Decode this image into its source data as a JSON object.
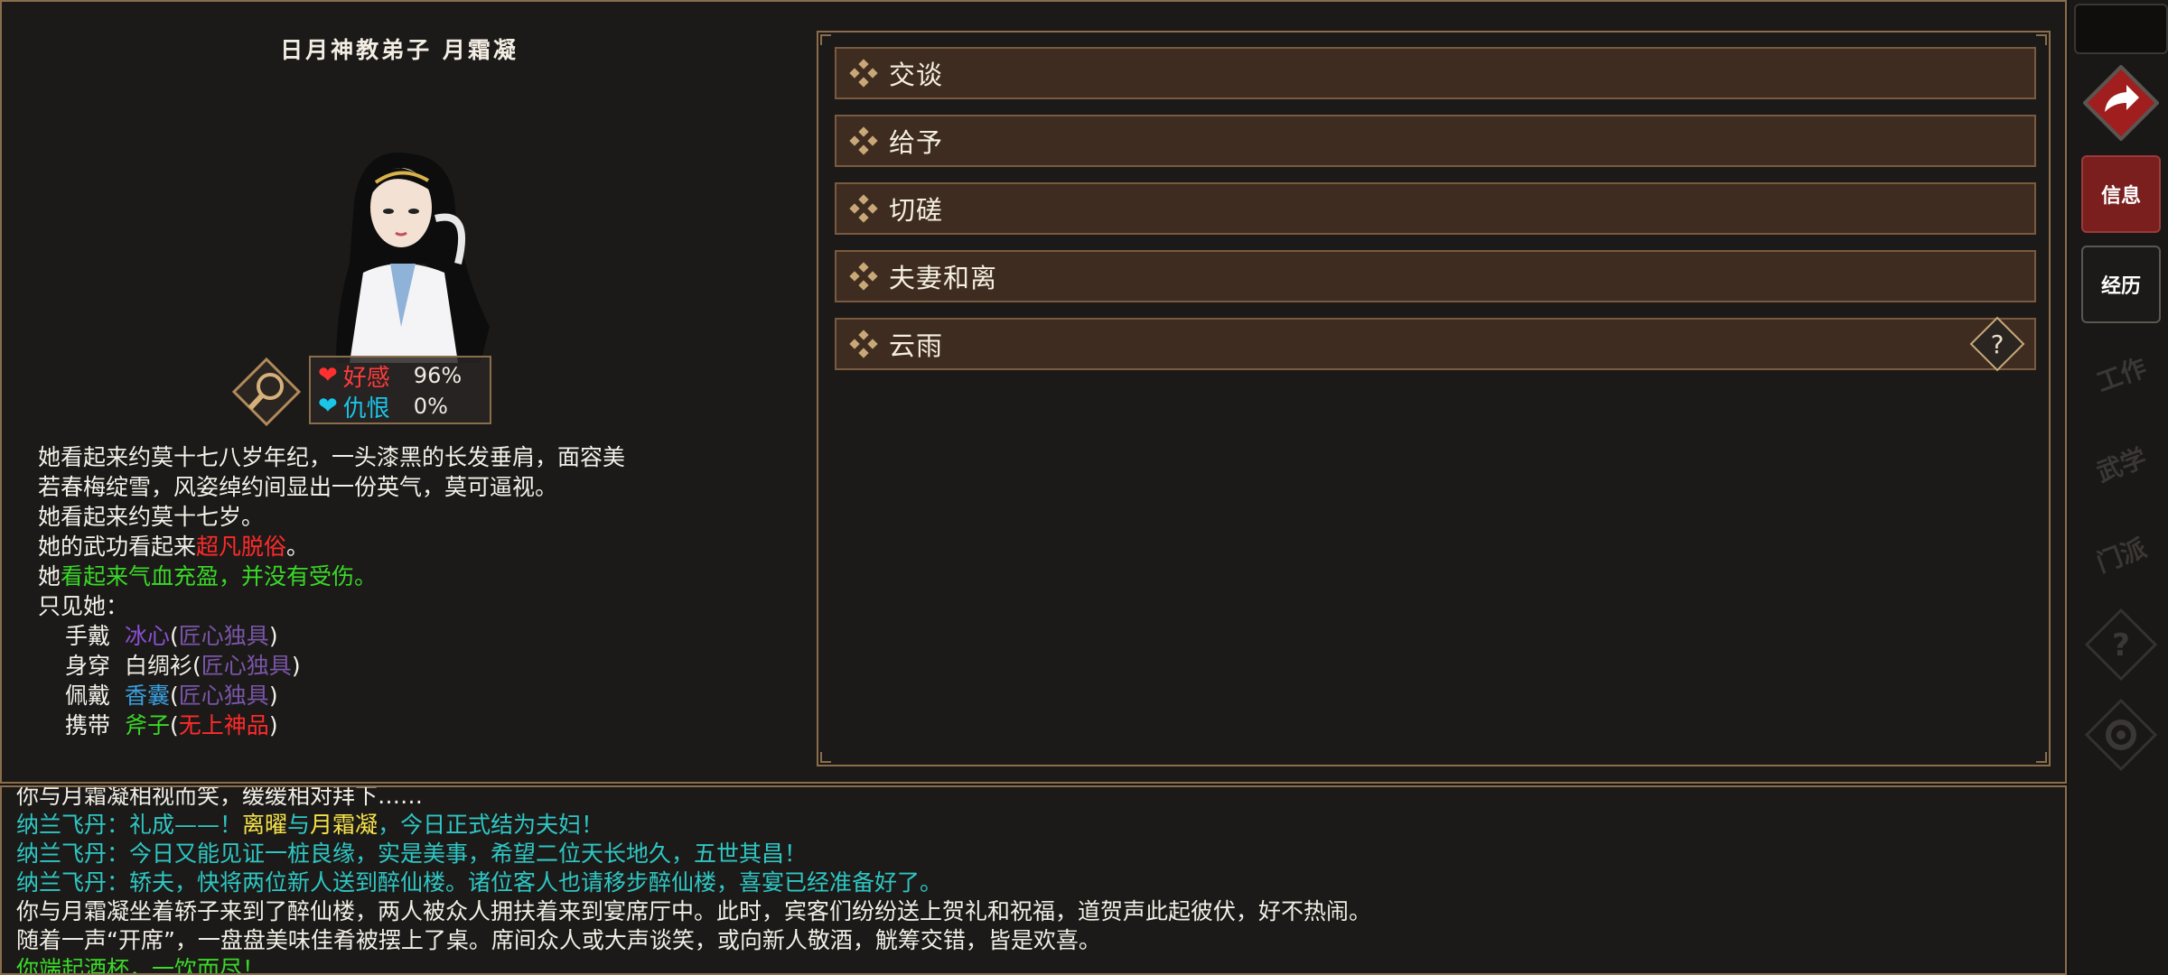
{
  "npc": {
    "title": "日月神教弟子  月霜凝",
    "favor_label": "好感",
    "favor_value": "96%",
    "hatred_label": "仇恨",
    "hatred_value": "0%",
    "favor_percent": 96,
    "hatred_percent": 0
  },
  "description": {
    "line1": "她看起来约莫十七八岁年纪，一头漆黑的长发垂肩，面容美",
    "line2": "若春梅绽雪，风姿绰约间显出一份英气，莫可逼视。",
    "line3": "她看起来约莫十七岁。",
    "martial_prefix": "她的武功看起来",
    "martial_value": "超凡脱俗",
    "martial_suffix": "。",
    "health_prefix": "她",
    "health_value": "看起来气血充盈，并没有受伤。",
    "equip_header": "只见她："
  },
  "equipment": [
    {
      "slot": "手戴",
      "item": "冰心",
      "open": "(",
      "quality": "匠心独具",
      "close": ")"
    },
    {
      "slot": "身穿",
      "item": "白绸衫",
      "open": "(",
      "quality": "匠心独具",
      "close": ")"
    },
    {
      "slot": "佩戴",
      "item": "香囊",
      "open": "(",
      "quality": "匠心独具",
      "close": ")"
    },
    {
      "slot": "携带",
      "item": "斧子",
      "open": "(",
      "quality": "无上神品",
      "close": ")"
    }
  ],
  "actions": [
    {
      "label": "交谈"
    },
    {
      "label": "给予"
    },
    {
      "label": "切磋"
    },
    {
      "label": "夫妻和离"
    },
    {
      "label": "云雨"
    }
  ],
  "sidebar": {
    "tabs": [
      {
        "label": "信息",
        "active": true
      },
      {
        "label": "经历",
        "active": false
      }
    ],
    "disabled": [
      {
        "label": "工作",
        "icon": "work-icon"
      },
      {
        "label": "武学",
        "icon": "martial-icon"
      },
      {
        "label": "门派",
        "icon": "sect-icon"
      },
      {
        "label": "?",
        "icon": "help-icon"
      },
      {
        "label": "",
        "icon": "gear-icon"
      }
    ]
  },
  "log": {
    "l0": "你与月霜凝相视而笑，缓缓相对拜下……",
    "l1a": "纳兰飞丹：礼成——！",
    "l1b": "离曜",
    "l1c": "与",
    "l1d": "月霜凝",
    "l1e": "，今日正式结为夫妇！",
    "l2": "纳兰飞丹：今日又能见证一桩良缘，实是美事，希望二位天长地久，五世其昌！",
    "l3": "纳兰飞丹：轿夫，快将两位新人送到醉仙楼。诸位客人也请移步醉仙楼，喜宴已经准备好了。",
    "l4": "你与月霜凝坐着轿子来到了醉仙楼，两人被众人拥扶着来到宴席厅中。此时，宾客们纷纷送上贺礼和祝福，道贺声此起彼伏，好不热闹。",
    "l5": "随着一声“开席”，一盘盘美味佳肴被摆上了桌。席间众人或大声谈笑，或向新人敬酒，觥筹交错，皆是欢喜。",
    "l6": "你端起酒杯，一饮而尽！"
  },
  "colors": {
    "panel_bg": "#1c1a18",
    "border_gold": "#8a6d4a",
    "button_bg": "#3f2c20",
    "active_tab": "#7a1e1e",
    "log_cyan": "#2ec7c4",
    "log_yellow": "#f6e24a",
    "log_green": "#39d928",
    "quality_red": "#ff2a2a",
    "quality_purple": "#7a55a8"
  }
}
